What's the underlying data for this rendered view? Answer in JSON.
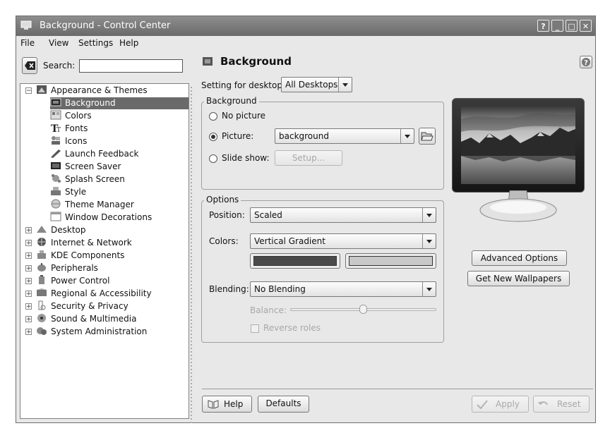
{
  "window": {
    "title": "Background - Control Center",
    "controls": [
      "?",
      "_",
      "□",
      "✕"
    ]
  },
  "menu": {
    "file": "File",
    "view": "View",
    "settings": "Settings",
    "help": "Help"
  },
  "search": {
    "label": "Search:",
    "value": ""
  },
  "tree": {
    "groups": [
      {
        "label": "Appearance & Themes",
        "icon": "appearance-icon",
        "expanded": true,
        "children": [
          {
            "label": "Background",
            "icon": "background-icon",
            "selected": true
          },
          {
            "label": "Colors",
            "icon": "colors-icon"
          },
          {
            "label": "Fonts",
            "icon": "fonts-icon"
          },
          {
            "label": "Icons",
            "icon": "icons-icon"
          },
          {
            "label": "Launch Feedback",
            "icon": "launch-feedback-icon"
          },
          {
            "label": "Screen Saver",
            "icon": "screen-saver-icon"
          },
          {
            "label": "Splash Screen",
            "icon": "splash-screen-icon"
          },
          {
            "label": "Style",
            "icon": "style-icon"
          },
          {
            "label": "Theme Manager",
            "icon": "theme-manager-icon"
          },
          {
            "label": "Window Decorations",
            "icon": "window-decorations-icon"
          }
        ]
      },
      {
        "label": "Desktop",
        "icon": "desktop-icon"
      },
      {
        "label": "Internet & Network",
        "icon": "internet-icon"
      },
      {
        "label": "KDE Components",
        "icon": "kde-components-icon"
      },
      {
        "label": "Peripherals",
        "icon": "peripherals-icon"
      },
      {
        "label": "Power Control",
        "icon": "power-control-icon"
      },
      {
        "label": "Regional & Accessibility",
        "icon": "regional-icon"
      },
      {
        "label": "Security & Privacy",
        "icon": "security-icon"
      },
      {
        "label": "Sound & Multimedia",
        "icon": "sound-icon"
      },
      {
        "label": "System Administration",
        "icon": "system-admin-icon"
      }
    ]
  },
  "panel": {
    "title": "Background",
    "setting_for_desktop_label": "Setting for desktop:",
    "desktop_value": "All Desktops",
    "background_group": {
      "title": "Background",
      "no_picture": "No picture",
      "picture": "Picture:",
      "picture_value": "background",
      "slide_show": "Slide show:",
      "setup": "Setup...",
      "selected": "picture"
    },
    "options_group": {
      "title": "Options",
      "position_label": "Position:",
      "position_value": "Scaled",
      "colors_label": "Colors:",
      "colors_value": "Vertical Gradient",
      "color1": "#4a4a4a",
      "color2": "#c8c8c8",
      "blending_label": "Blending:",
      "blending_value": "No Blending",
      "balance_label": "Balance:",
      "balance_level": 0.5,
      "reverse_roles": "Reverse roles"
    },
    "advanced_options": "Advanced Options",
    "get_new_wallpapers": "Get New Wallpapers"
  },
  "footer": {
    "help": "Help",
    "defaults": "Defaults",
    "apply": "Apply",
    "reset": "Reset"
  }
}
